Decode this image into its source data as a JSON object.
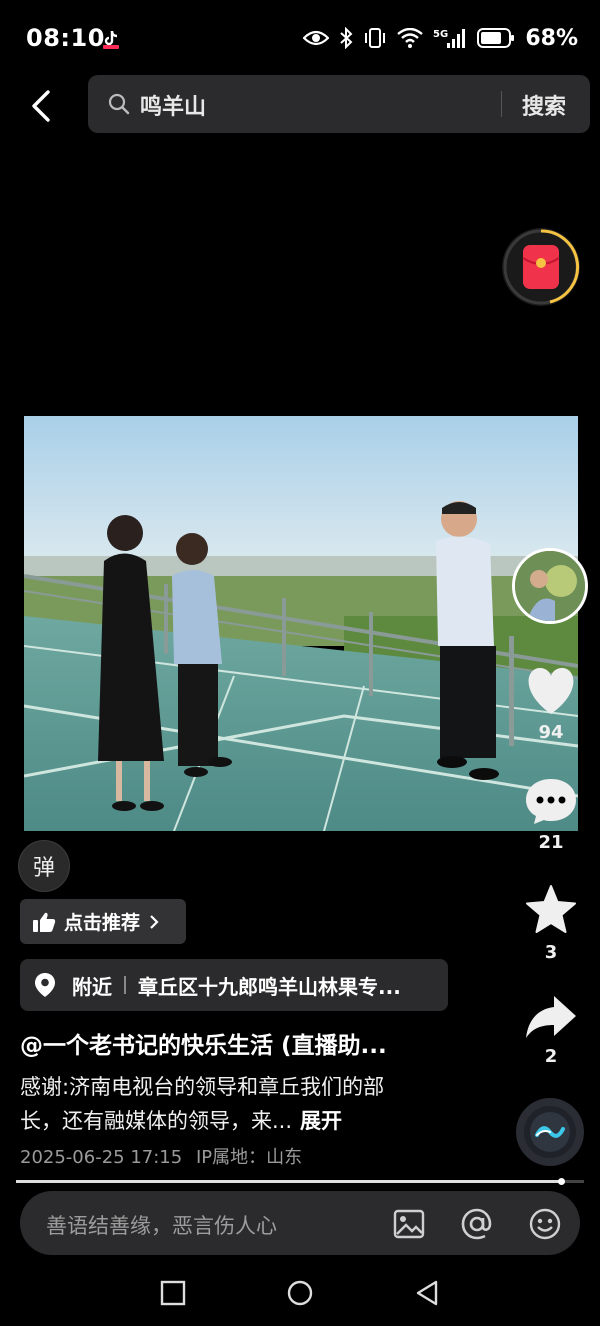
{
  "status": {
    "time": "08:10",
    "battery_pct": "68%",
    "network": "5G"
  },
  "search": {
    "query": "鸣羊山",
    "button": "搜索"
  },
  "rail": {
    "likes": "94",
    "comments": "21",
    "favorites": "3",
    "shares": "2"
  },
  "overlay": {
    "danmu_label": "弹",
    "recommend_label": "点击推荐",
    "location_prefix": "附近",
    "location_name": "章丘区十九郎鸣羊山林果专...",
    "author": "@一个老书记的快乐生活 (直播助...",
    "description_line1": "感谢:济南电视台的领导和章丘我们的部",
    "description_line2": "长，还有融媒体的领导，来...",
    "expand": "展开",
    "date": "2025-06-25 17:15",
    "ip_location": "IP属地：山东"
  },
  "playback": {
    "progress": 0.96
  },
  "comment_bar": {
    "placeholder": "善语结善缘，恶言伤人心"
  },
  "colors": {
    "background": "#000000",
    "panel": "#2b2b2d",
    "red_packet": "#f0334b",
    "ring": "#f5c242"
  },
  "icons": [
    "back-icon",
    "search-icon",
    "red-packet-icon",
    "heart-icon",
    "comment-icon",
    "star-icon",
    "share-icon",
    "music-disc-icon",
    "thumb-up-icon",
    "location-pin-icon",
    "image-icon",
    "at-icon",
    "emoji-icon"
  ]
}
